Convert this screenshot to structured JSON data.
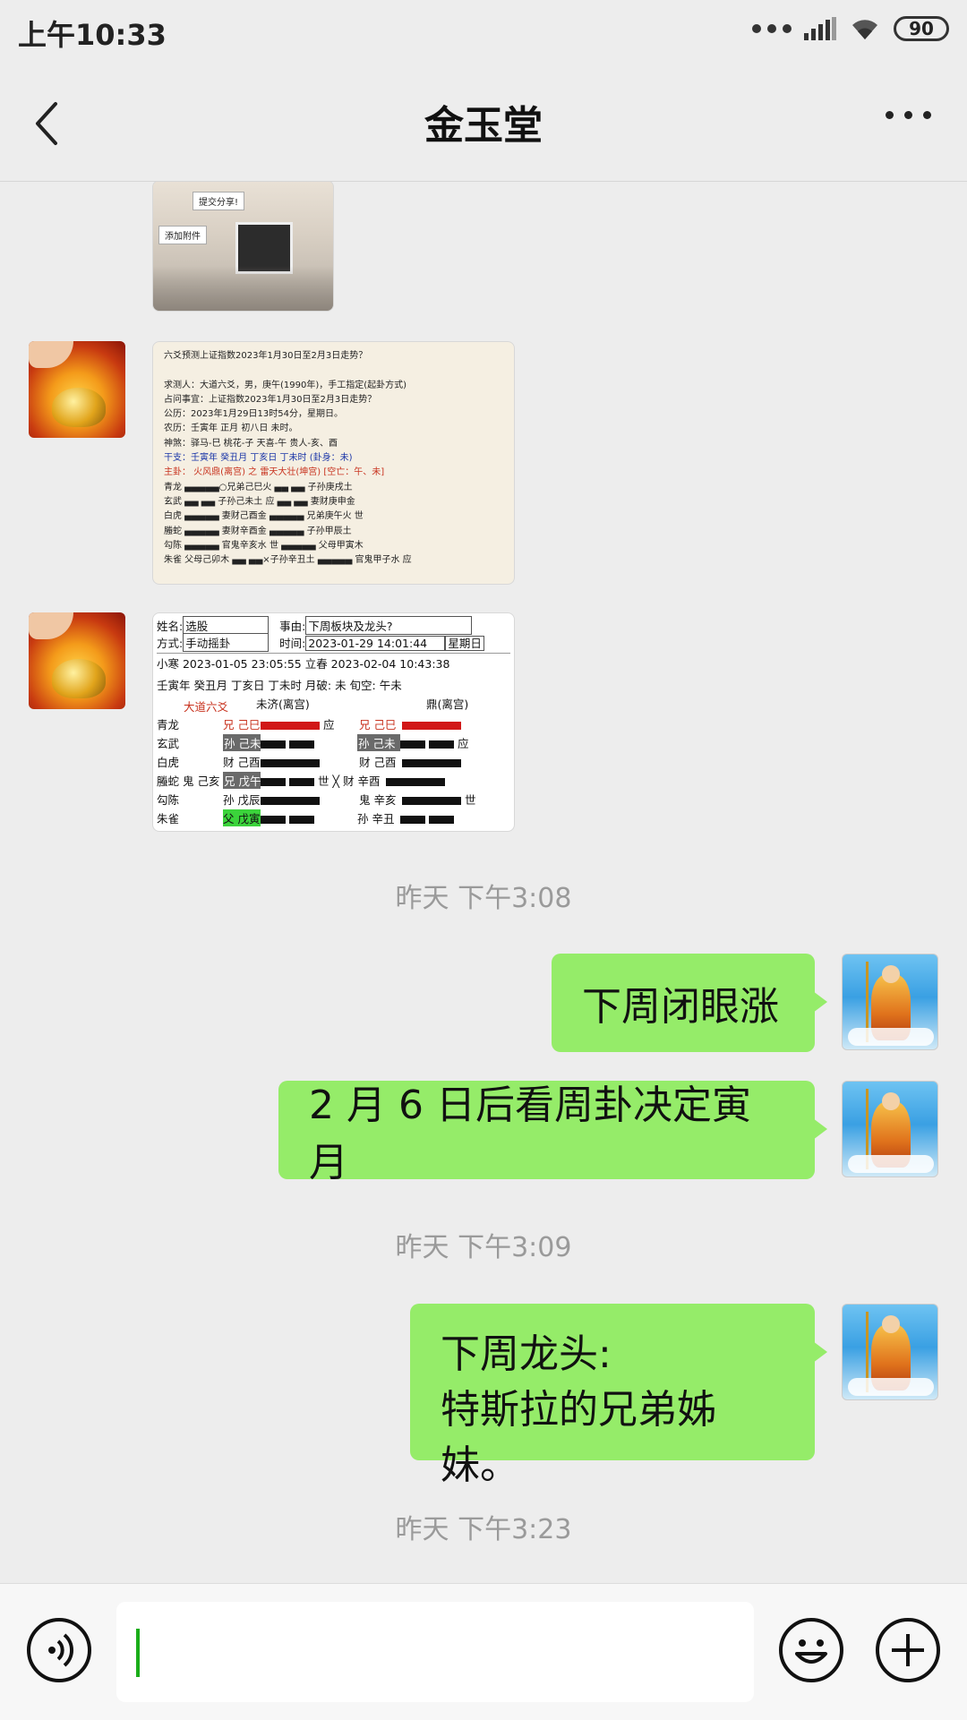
{
  "status_bar": {
    "time": "上午10:33",
    "battery": "90"
  },
  "nav": {
    "title": "金玉堂"
  },
  "image_message_1": {
    "tags": [
      "提交分享!",
      "添加附件"
    ]
  },
  "image_message_2": {
    "lines": [
      "六爻预测上证指数2023年1月30日至2月3日走势？",
      "",
      "求测人：大道六爻，男，庚午(1990年)，手工指定(起卦方式)",
      "占问事宜：上证指数2023年1月30日至2月3日走势？",
      "公历：2023年1月29日13时54分，星期日。",
      "农历：壬寅年 正月 初八日 未时。",
      "神煞：驿马-巳 桃花-子 天喜-午 贵人-亥、酉",
      "干支：壬寅年   癸丑月   丁亥日   丁未时  (卦身：未)",
      "主卦：       火风鼎(离宫)    之    雷天大壮(坤宫)   [空亡：午、未]",
      "青龙          ▄▄▄▄▄○兄弟己巳火        ▄▄ ▄▄   子孙庚戌土",
      "玄武          ▄▄ ▄▄  子孙己未土 应    ▄▄ ▄▄   妻财庚申金",
      "白虎          ▄▄▄▄▄  妻财己酉金       ▄▄▄▄▄   兄弟庚午火  世",
      "螣蛇          ▄▄▄▄▄  妻财辛酉金       ▄▄▄▄▄   子孙甲辰土",
      "勾陈          ▄▄▄▄▄  官鬼辛亥水  世   ▄▄▄▄▄   父母甲寅木",
      "朱雀   父母己卯木  ▄▄ ▄▄×子孙辛丑土       ▄▄▄▄▄   官鬼甲子水  应"
    ]
  },
  "image_message_3": {
    "name_label": "姓名:",
    "name_value": "选股",
    "matter_label": "事由:",
    "matter_value": "下周板块及龙头?",
    "method_label": "方式:",
    "method_value": "手动摇卦",
    "time_label": "时间:",
    "time_value": "2023-01-29 14:01:44",
    "weekday": "星期日",
    "jieqi": "小寒  2023-01-05 23:05:55   立春  2023-02-04 10:43:38",
    "ganzhi": "壬寅年  癸丑月  丁亥日  丁未时   月破: 未    旬空: 午未",
    "header_left_title": "大道六爻",
    "header_left_gua": "未济(离宫)",
    "header_right_gua": "鼎(离宫)",
    "rows": [
      {
        "god": "青龙",
        "left": "兄 己巳",
        "right": "兄 己巳",
        "left_mark": "应",
        "right_mark": ""
      },
      {
        "god": "玄武",
        "left": "孙 己未",
        "right": "孙 己未",
        "left_mark": "",
        "right_mark": "应"
      },
      {
        "god": "白虎",
        "left": "财 己酉",
        "right": "财 己酉",
        "left_mark": "",
        "right_mark": ""
      },
      {
        "god": "螣蛇 鬼 己亥",
        "left": "兄 戊午",
        "right": "财 辛酉",
        "left_mark": "世",
        "right_mark": ""
      },
      {
        "god": "勾陈",
        "left": "孙 戊辰",
        "right": "鬼 辛亥",
        "left_mark": "",
        "right_mark": "世"
      },
      {
        "god": "朱雀",
        "left": "父 戊寅",
        "right": "孙 辛丑",
        "left_mark": "",
        "right_mark": ""
      }
    ],
    "cross": "╳"
  },
  "timestamps": [
    "昨天 下午3:08",
    "昨天 下午3:09",
    "昨天 下午3:23"
  ],
  "messages_sent": [
    {
      "text": "下周闭眼涨"
    },
    {
      "text": "2 月 6 日后看周卦决定寅月"
    },
    {
      "line1": "下周龙头:",
      "line2": "特斯拉的兄弟姊妹。"
    }
  ],
  "colors": {
    "bubble": "#95ec69",
    "background": "#ededed",
    "caret": "#1aad19"
  },
  "icons": [
    "back-arrow-icon",
    "more-icon",
    "voice-icon",
    "emoji-icon",
    "plus-icon",
    "signal-icon",
    "wifi-icon",
    "battery-icon"
  ]
}
